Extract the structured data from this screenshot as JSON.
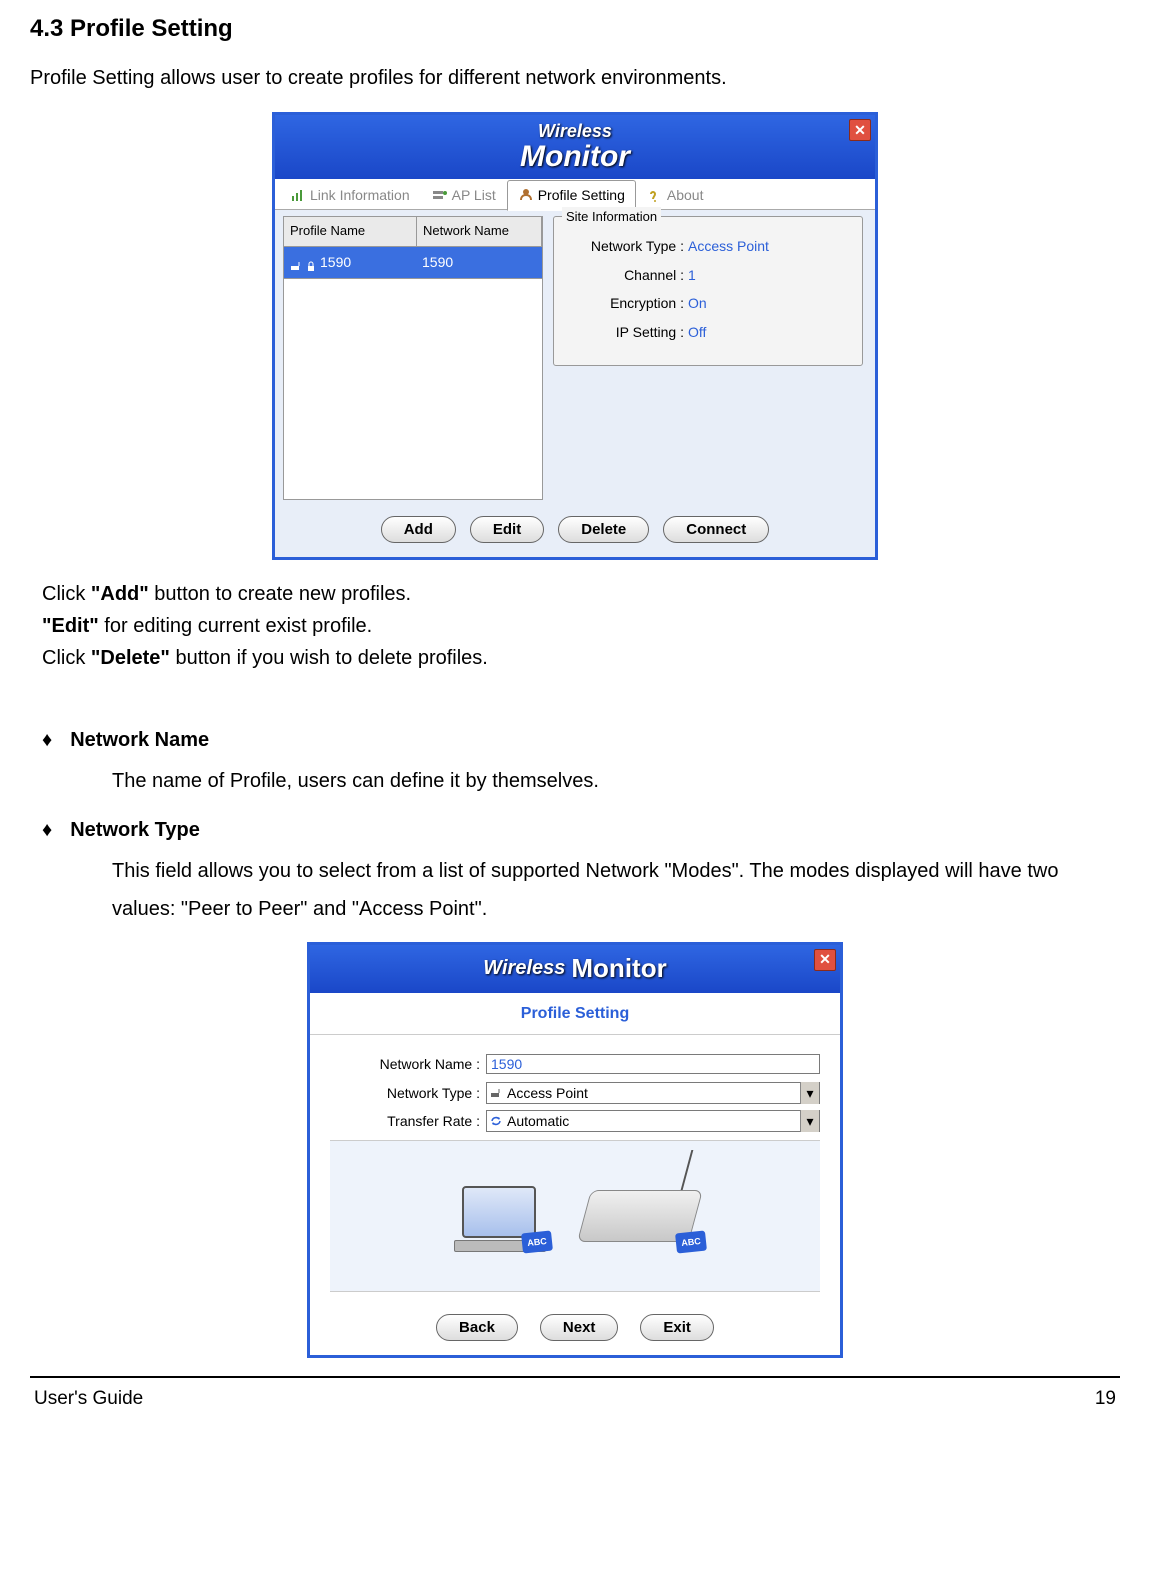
{
  "doc": {
    "heading": "4.3 Profile Setting",
    "intro": "Profile Setting allows user to create profiles for different network environments.",
    "para1_a": "Click ",
    "para1_b": "\"Add\"",
    "para1_c": " button to create new profiles.",
    "para2_a": "\"Edit\"",
    "para2_b": " for editing current exist profile.",
    "para3_a": "Click ",
    "para3_b": "\"Delete\"",
    "para3_c": " button if you wish to delete profiles.",
    "bullet1_title": "Network Name",
    "bullet1_body": "The name of Profile, users can define it by themselves.",
    "bullet2_title": "Network Type",
    "bullet2_body": "This field allows you to select from a list of supported Network \"Modes\".  The modes displayed will have two values:  \"Peer to Peer\" and \"Access Point\".",
    "footer_left": "User's Guide",
    "footer_right": "19"
  },
  "app1": {
    "logo_top": "Wireless",
    "logo_bot": "Monitor",
    "tabs": {
      "link_info": "Link Information",
      "ap_list": "AP List",
      "profile": "Profile Setting",
      "about": "About"
    },
    "list": {
      "col_profile": "Profile Name",
      "col_network": "Network Name",
      "row_profile": "1590",
      "row_network": "1590"
    },
    "site": {
      "legend": "Site Information",
      "network_type_k": "Network Type :",
      "network_type_v": "Access Point",
      "channel_k": "Channel :",
      "channel_v": "1",
      "encryption_k": "Encryption :",
      "encryption_v": "On",
      "ip_k": "IP Setting :",
      "ip_v": "Off"
    },
    "buttons": {
      "add": "Add",
      "edit": "Edit",
      "del": "Delete",
      "connect": "Connect"
    }
  },
  "app2": {
    "logo_w": "Wireless",
    "logo_m": "Monitor",
    "subhead": "Profile Setting",
    "labels": {
      "network_name": "Network Name :",
      "network_type": "Network Type :",
      "transfer_rate": "Transfer Rate :"
    },
    "values": {
      "network_name": "1590",
      "network_type": "Access Point",
      "transfer_rate": "Automatic"
    },
    "abc": "ABC",
    "buttons": {
      "back": "Back",
      "next": "Next",
      "exit": "Exit"
    }
  }
}
